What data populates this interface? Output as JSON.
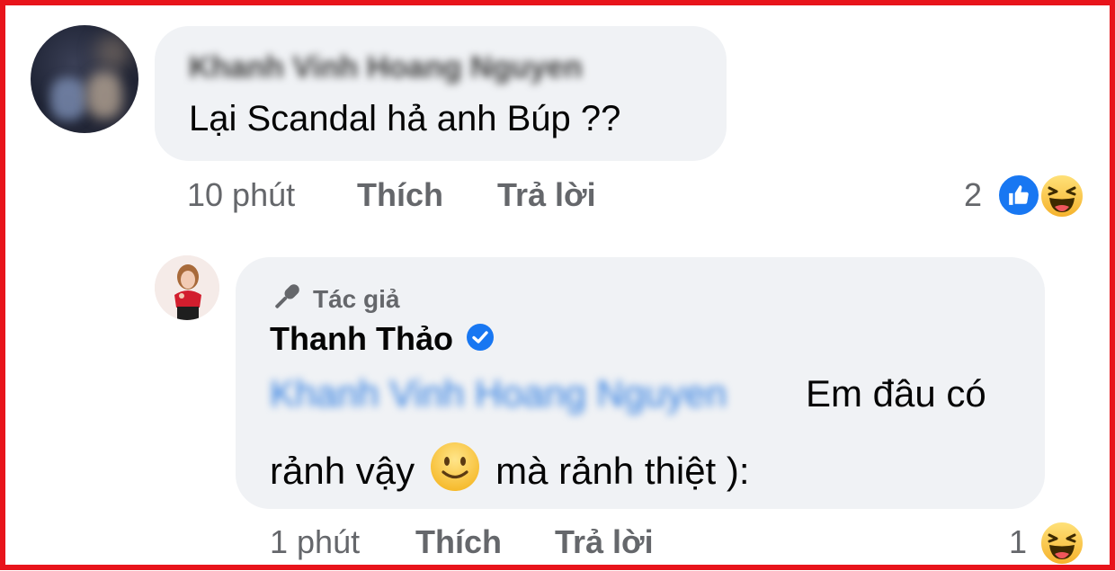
{
  "comments": [
    {
      "author_name_blurred": "Khanh Vinh Hoang Nguyen",
      "text": "Lại Scandal hả anh Búp ??",
      "time": "10 phút",
      "like_label": "Thích",
      "reply_label": "Trả lời",
      "reaction_count": "2",
      "reactions": [
        "like-icon",
        "haha-icon"
      ]
    },
    {
      "badge_label": "Tác giả",
      "author_name": "Thanh Thảo",
      "verified": true,
      "mention_blurred": "Khanh Vinh Hoang Nguyen",
      "text_line1": "Em đâu có",
      "text_line2_before": "rảnh vậy",
      "text_line2_after": "mà rảnh thiệt ):",
      "time": "1 phút",
      "like_label": "Thích",
      "reply_label": "Trả lời",
      "reaction_count": "1",
      "reactions": [
        "haha-icon"
      ]
    }
  ],
  "colors": {
    "frame": "#e8141b",
    "bubble": "#f0f2f5",
    "meta_text": "#65676b",
    "like_blue": "#1877f2",
    "mention_blue": "#2c7be0"
  }
}
